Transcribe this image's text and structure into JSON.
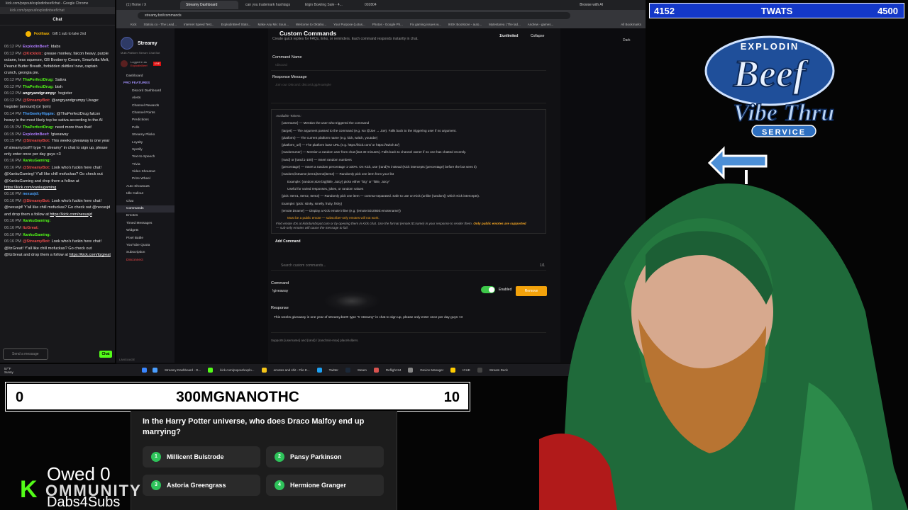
{
  "chat": {
    "url": "kick.com/popout/explodinbeef/chat - Google Chrome",
    "url2": "kick.com/popout/explodinbeef/chat",
    "title": "Chat",
    "gift_user": "Foolilaax",
    "gift_text": "Gift 1 sub to take 2nd",
    "messages": [
      {
        "time": "06:12 PM",
        "user": "ExplodinBeef:",
        "color": "#b07cff",
        "text": "Idabs"
      },
      {
        "time": "06:12 PM",
        "user": "@Kicklolz:",
        "color": "#e84a4a",
        "text": "grease monkey, falcon heavy, purple octane, tess squeeze, GB Booberry Cream, Smurfzilla Melt, Peanut Butter Breath, forbidden zkittles! new, captain crunch, georgia pie."
      },
      {
        "time": "06:12 PM",
        "user": "ThaPerfectDrug:",
        "color": "#53fc18",
        "text": "Sativa"
      },
      {
        "time": "06:12 PM",
        "user": "ThaPerfectDrug:",
        "color": "#53fc18",
        "text": "bish"
      },
      {
        "time": "06:12 PM",
        "user": "angryandgrumpy:",
        "color": "#ffffff",
        "text": "!register"
      },
      {
        "time": "06:12 PM",
        "user": "@StreamyBot:",
        "color": "#e84a4a",
        "text": "@angryandgrumpy Usage: !register [amount] (or !join)"
      },
      {
        "time": "06:14 PM",
        "user": "TheGeekyHippie:",
        "color": "#4aa3ff",
        "text": "@ThaPerfectDrug falcon heavy is the most likely top be sativa according to the AI"
      },
      {
        "time": "06:15 PM",
        "user": "ThaPerfectDrug:",
        "color": "#53fc18",
        "text": "need more than that!"
      },
      {
        "time": "06:15 PM",
        "user": "ExplodinBeef:",
        "color": "#b07cff",
        "text": "!giveaway"
      },
      {
        "time": "06:15 PM",
        "user": "@StreamyBot:",
        "color": "#e84a4a",
        "text": "This weeks giveaway is one year of streamy.bot!!! type \"!r streamy\" in chat to sign up, please only enter once per day guys <3"
      },
      {
        "time": "06:16 PM",
        "user": "XankuGaming:",
        "color": "#53fc18",
        "text": ""
      },
      {
        "time": "06:16 PM",
        "user": "@StreamyBot:",
        "color": "#e84a4a",
        "text": "Look who's fuckin here chat! @XankuGaming! Y'all like chill mofuckas? Go check out @XankuGaming and drop them a follow at",
        "link": "https://kick.com/xankugaming"
      },
      {
        "time": "06:16 PM",
        "user": "nexusjd:",
        "color": "#4aa3ff",
        "text": ""
      },
      {
        "time": "06:16 PM",
        "user": "@StreamyBot:",
        "color": "#e84a4a",
        "text": "Look who's fuckin here chat! @nexusjd! Y'all like chill mofuckas? Go check out @nexusjd and drop them a follow at",
        "link": "https://kick.com/nexusjd"
      },
      {
        "time": "06:16 PM",
        "user": "XankuGaming:",
        "color": "#53fc18",
        "text": ""
      },
      {
        "time": "06:16 PM",
        "user": "ItzGreat:",
        "color": "#e84a4a",
        "text": ""
      },
      {
        "time": "06:16 PM",
        "user": "XankuGaming:",
        "color": "#53fc18",
        "text": ""
      },
      {
        "time": "06:16 PM",
        "user": "@StreamyBot:",
        "color": "#e84a4a",
        "text": "Look who's fuckin here chat! @ItzGreat! Y'all like chill mofuckas? Go check out @ItzGreat and drop them a follow at",
        "link": "https://kick.com/itzgreat"
      }
    ],
    "input_placeholder": "Send a message",
    "chat_button": "Chat"
  },
  "browser": {
    "tabs": [
      "(1) Home / X",
      "Streamy Dashboard",
      "can you trademark hashtags",
      "Elgin Bowling Sale - 4...",
      "002804"
    ],
    "tab_right": "Browse with AI",
    "url": "streamy.bot/commands",
    "bookmarks": [
      "Kick",
      "Statsio.co - The Lead...",
      "Internet Speed Test...",
      "ExplodinBeef Stats...",
      "Make Any Mic Soun...",
      "Welcome to Oktaho...",
      "Your Purpose (Lotus...",
      "Photos - Google Ph...",
      "Fix gaming issues w...",
      "IKEK Bootstore - auto...",
      "Mytestarea | The lad...",
      "Andrew - games..."
    ],
    "all_bookmarks": "All Bookmarks"
  },
  "sidebar": {
    "brand": "Streamy",
    "brand_sub": "Multi-Platform Stream Chat Bot",
    "logged_in": "Logged in as",
    "user": "ExplodinBeef",
    "live": "LIVE",
    "items": [
      {
        "label": "Dashboard",
        "kind": "top"
      },
      {
        "label": "PRO FEATURES",
        "kind": "head"
      },
      {
        "label": "Discord Dashboard",
        "kind": "sub"
      },
      {
        "label": "Alerts",
        "kind": "sub"
      },
      {
        "label": "Channel Rewards",
        "kind": "sub"
      },
      {
        "label": "Channel Points",
        "kind": "sub"
      },
      {
        "label": "Predictions",
        "kind": "sub"
      },
      {
        "label": "Polls",
        "kind": "sub"
      },
      {
        "label": "Streamy Plinko",
        "kind": "sub"
      },
      {
        "label": "Loyalty",
        "kind": "sub"
      },
      {
        "label": "Spotify",
        "kind": "sub"
      },
      {
        "label": "Text-to-Speech",
        "kind": "sub"
      },
      {
        "label": "Trivia",
        "kind": "sub"
      },
      {
        "label": "Video Shoutout",
        "kind": "sub"
      },
      {
        "label": "Prize Wheel",
        "kind": "sub"
      },
      {
        "label": "Auto Shoutouts",
        "kind": "top"
      },
      {
        "label": "Idle Callout",
        "kind": "top"
      },
      {
        "label": "Chat",
        "kind": "top"
      },
      {
        "label": "Commands",
        "kind": "active"
      },
      {
        "label": "Emotes",
        "kind": "top"
      },
      {
        "label": "Timed Messages",
        "kind": "top"
      },
      {
        "label": "Widgets",
        "kind": "top"
      },
      {
        "label": "Pixel Battle",
        "kind": "top"
      },
      {
        "label": "YouTube Quota",
        "kind": "top"
      },
      {
        "label": "Subscription",
        "kind": "top"
      },
      {
        "label": "Disconnect",
        "kind": "danger"
      }
    ],
    "language": "LANGUAGE"
  },
  "commands": {
    "title": "Custom Commands",
    "subtitle": "Create quick replies for FAQs, links, or reminders. Each command responds instantly in chat.",
    "count": "1/unlimited",
    "collapse": "Collapse",
    "dark": "Dark",
    "name_label": "Command Name",
    "name_placeholder": "!discord",
    "response_label": "Response Message",
    "response_placeholder": "Join our Discord: discord.gg/example",
    "tokens_title": "Available Tokens:",
    "tokens": [
      "{username} — Mention the user who triggered the command",
      "{target} — The argument passed to the command (e.g. !so @Joe → Joe). Falls back to the triggering user if no argument.",
      "{platform} — The current platform name (e.g. kick, twitch, youtube)",
      "{platform_url} — The platform base URL (e.g. https://kick.com/ or https://twitch.tv/)",
      "{randomUser} — Mention a random user from chat (last 30 minutes). Falls back to channel owner if no one has chatted recently.",
      "{rand} or {rand:1-100} — Insert random numbers",
      "{percentage} — Insert a random percentage 1-100%. On Kick, use {rand}% instead (Kick intercepts {percentage} before the bot sees it)",
      "{random;listname;item1|item2|item3} — Randomly pick one item from your list"
    ],
    "token_subs": [
      "Example: {random;size;big|little, Juicy} picks either \"big\" or \"little, Juicy\"",
      "Useful for varied responses, jokes, or random values"
    ],
    "tokens2": [
      "{pick: Item1, Item2, Item3} — Randomly pick one item — comma-separated. Safe to use on Kick (unlike {random}) which Kick intercepts).",
      "Example: {pick: stinky, smelly, fruity, fishy}",
      "{emote:Dname} — Display a Kick emote inline (e.g. {emote:5010930:emotename})"
    ],
    "warn": "Must be a public emote — subscriber-only emotes will not work.",
    "foot1": "Find emote IDs at kickdumbspot.com or by opening them in Kick chat. Use the format {emote:ID:name} in your response to render them.",
    "foot_orange": "Only public emotes are supported",
    "foot2": "— sub-only emotes will cause the message to fail.",
    "add_button": "Add Command",
    "search_placeholder": "Search custom commands...",
    "search_count": "1/1",
    "command_label": "Command",
    "command_value": "!giveaway",
    "enabled": "Enabled",
    "remove": "Remove",
    "resp_label": "Response",
    "resp_value": "This weeks giveaway is one year of streamy.bot!!! type \"!r streamy\" in chat to sign up, please only enter once per day guys <3",
    "supports": "Supports {username} and {rand} / {rand:min-max} placeholders."
  },
  "taskbar": {
    "weather": "57°F",
    "weather2": "Sunny",
    "items": [
      "Streamy Dashboard - G...",
      "kick.com/popout/explo...",
      "emotes and shit - File E...",
      "Twitter",
      "Steam",
      "Reflight 84",
      "Device Manager",
      "ICUE",
      "Stream Deck"
    ]
  },
  "scoreboard": {
    "left": "4152",
    "center": "TWATS",
    "right": "4500"
  },
  "logo": {
    "top": "EXPLODIN",
    "main": "Beef",
    "sub1": "Vibe Thru",
    "sub2": "SERVICE"
  },
  "trivia": {
    "left": "0",
    "title": "300MGNANOTHC",
    "right": "10",
    "question": "In the Harry Potter universe, who does Draco Malfoy end up marrying?",
    "answers": [
      {
        "n": "1",
        "text": "Millicent Bulstrode"
      },
      {
        "n": "2",
        "text": "Pansy Parkinson"
      },
      {
        "n": "3",
        "text": "Astoria Greengrass"
      },
      {
        "n": "4",
        "text": "Hermione Granger"
      }
    ]
  },
  "community": {
    "owed": "Owed 0",
    "k": "K",
    "rest": "OMMUNITY",
    "dabs": "Dabs4Subs"
  }
}
